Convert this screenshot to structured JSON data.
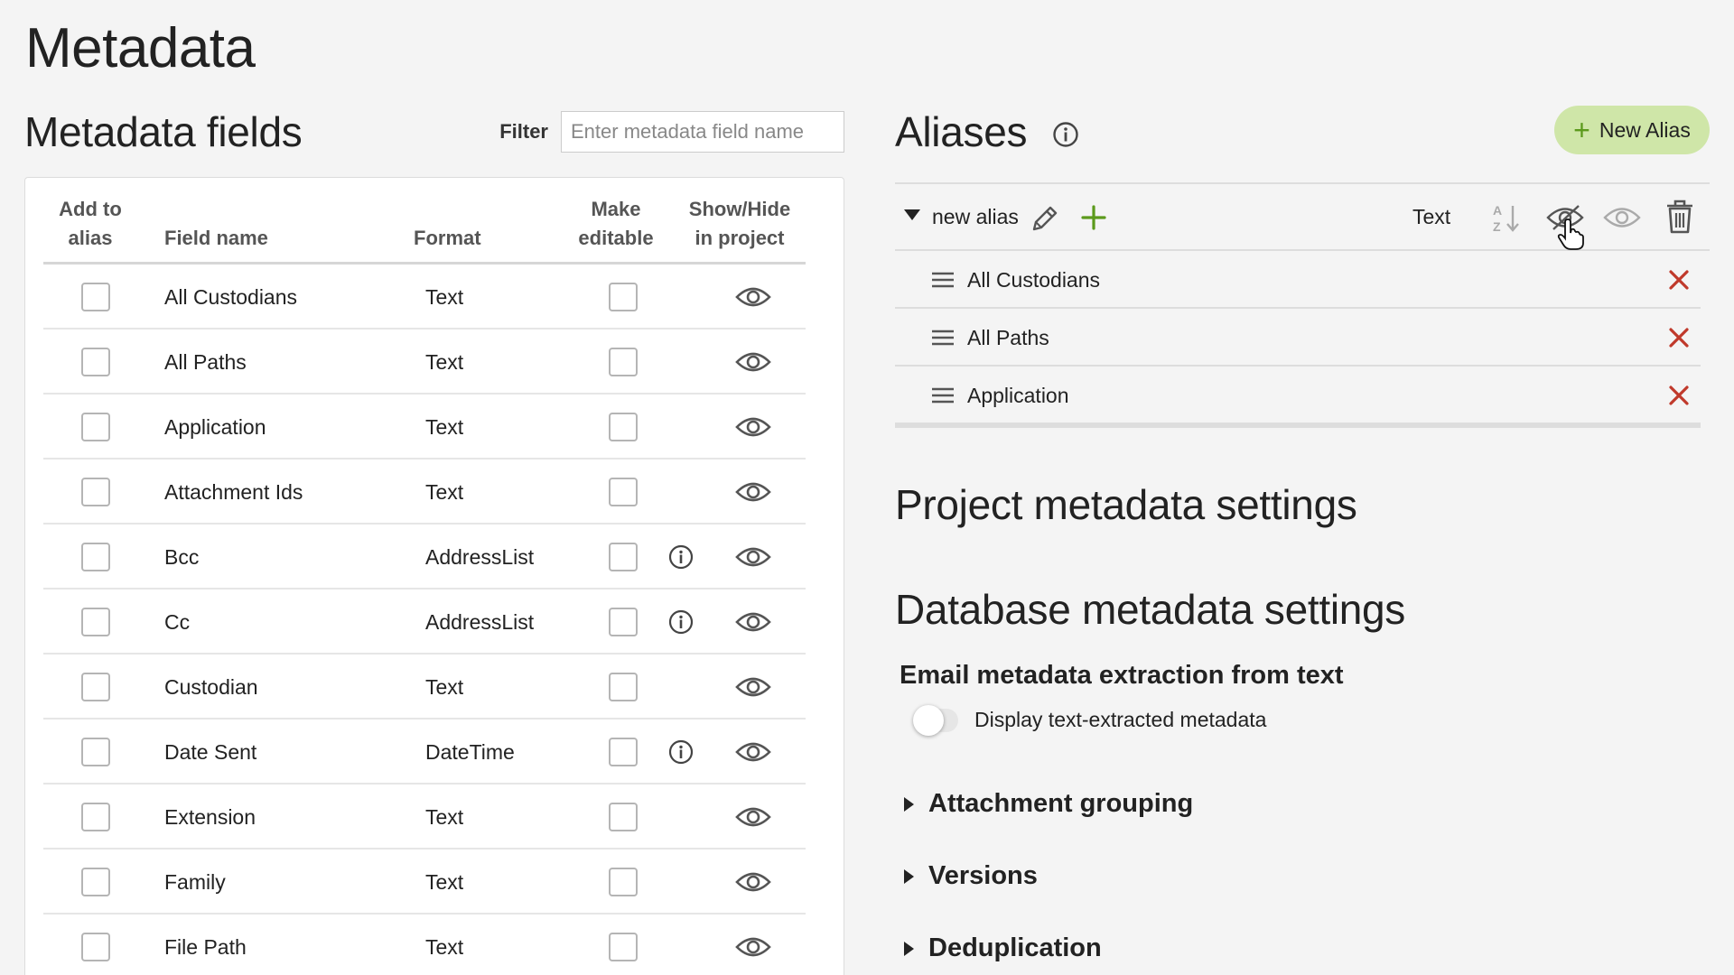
{
  "page": {
    "title": "Metadata"
  },
  "fields_panel": {
    "title": "Metadata fields",
    "filter_label": "Filter",
    "filter_placeholder": "Enter metadata field name",
    "filter_value": "",
    "columns": {
      "add_to_alias_1": "Add to",
      "add_to_alias_2": "alias",
      "field_name": "Field name",
      "format": "Format",
      "make_editable_1": "Make",
      "make_editable_2": "editable",
      "show_hide_1": "Show/Hide",
      "show_hide_2": "in project"
    },
    "rows": [
      {
        "name": "All Custodians",
        "format": "Text",
        "info": false,
        "add_to_alias": false,
        "editable": false,
        "visible": true
      },
      {
        "name": "All Paths",
        "format": "Text",
        "info": false,
        "add_to_alias": false,
        "editable": false,
        "visible": true
      },
      {
        "name": "Application",
        "format": "Text",
        "info": false,
        "add_to_alias": false,
        "editable": false,
        "visible": true
      },
      {
        "name": "Attachment Ids",
        "format": "Text",
        "info": false,
        "add_to_alias": false,
        "editable": false,
        "visible": true
      },
      {
        "name": "Bcc",
        "format": "AddressList",
        "info": true,
        "add_to_alias": false,
        "editable": false,
        "visible": true
      },
      {
        "name": "Cc",
        "format": "AddressList",
        "info": true,
        "add_to_alias": false,
        "editable": false,
        "visible": true
      },
      {
        "name": "Custodian",
        "format": "Text",
        "info": false,
        "add_to_alias": false,
        "editable": false,
        "visible": true
      },
      {
        "name": "Date Sent",
        "format": "DateTime",
        "info": true,
        "add_to_alias": false,
        "editable": false,
        "visible": true
      },
      {
        "name": "Extension",
        "format": "Text",
        "info": false,
        "add_to_alias": false,
        "editable": false,
        "visible": true
      },
      {
        "name": "Family",
        "format": "Text",
        "info": false,
        "add_to_alias": false,
        "editable": false,
        "visible": true
      },
      {
        "name": "File Path",
        "format": "Text",
        "info": false,
        "add_to_alias": false,
        "editable": false,
        "visible": true
      }
    ]
  },
  "aliases_panel": {
    "title": "Aliases",
    "new_alias_label": "New Alias",
    "alias": {
      "name": "new alias",
      "expanded": true,
      "format": "Text",
      "items": [
        "All Custodians",
        "All Paths",
        "Application"
      ]
    }
  },
  "settings": {
    "project_title": "Project metadata settings",
    "database_title": "Database metadata settings",
    "email_extraction_title": "Email metadata extraction from text",
    "toggle_label": "Display text-extracted metadata",
    "toggle_on": false,
    "sections": [
      "Attachment grouping",
      "Versions",
      "Deduplication"
    ]
  },
  "colors": {
    "accent_green": "#5c9a1c",
    "new_alias_bg": "#cfe6a8",
    "remove_red": "#c0392b",
    "icon_gray": "#555555"
  }
}
